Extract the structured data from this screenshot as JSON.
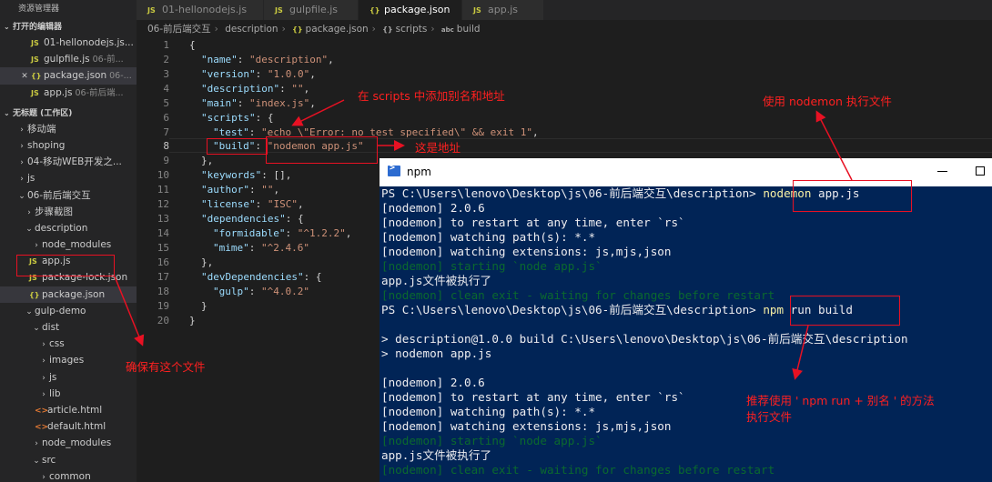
{
  "sidebar": {
    "title": "资源管理器",
    "open_editors_header": "打开的编辑器",
    "open_editors": [
      {
        "icon": "JS",
        "name": "01-hellonodejs.js...",
        "desc": ""
      },
      {
        "icon": "JS",
        "name": "gulpfile.js",
        "desc": "06-前..."
      },
      {
        "icon": "{}",
        "name": "package.json",
        "desc": "06-..."
      },
      {
        "icon": "JS",
        "name": "app.js",
        "desc": "06-前后端..."
      }
    ],
    "workspace_header": "无标题 (工作区)",
    "tree": [
      {
        "name": "移动端"
      },
      {
        "name": "shoping"
      },
      {
        "name": "04-移动WEB开发之..."
      },
      {
        "name": "js"
      },
      {
        "name": "06-前后端交互"
      },
      {
        "name": "步骤截图"
      },
      {
        "name": "description"
      },
      {
        "name": "node_modules"
      },
      {
        "icon": "JS",
        "name": "app.js"
      },
      {
        "icon": "JS",
        "name": "package-lock.json"
      },
      {
        "icon": "{}",
        "name": "package.json"
      },
      {
        "name": "gulp-demo"
      },
      {
        "name": "dist"
      },
      {
        "name": "css"
      },
      {
        "name": "images"
      },
      {
        "name": "js"
      },
      {
        "name": "lib"
      },
      {
        "icon": "<>",
        "name": "article.html"
      },
      {
        "icon": "<>",
        "name": "default.html"
      },
      {
        "name": "node_modules"
      },
      {
        "name": "src"
      },
      {
        "name": "common"
      }
    ]
  },
  "tabs": [
    {
      "icon": "JS",
      "label": "01-hellonodejs.js"
    },
    {
      "icon": "JS",
      "label": "gulpfile.js"
    },
    {
      "icon": "{}",
      "label": "package.json"
    },
    {
      "icon": "JS",
      "label": "app.js"
    }
  ],
  "breadcrumb": {
    "parts": [
      "06-前后端交互",
      "description",
      "package.json",
      "scripts",
      "build"
    ],
    "icons": [
      "{}",
      "{}",
      "abc"
    ]
  },
  "editor": {
    "lines": [
      {
        "n": "1",
        "t": "{"
      },
      {
        "n": "2",
        "k": "\"name\"",
        "v": "\"description\"",
        "e": ","
      },
      {
        "n": "3",
        "k": "\"version\"",
        "v": "\"1.0.0\"",
        "e": ","
      },
      {
        "n": "4",
        "k": "\"description\"",
        "v": "\"\"",
        "e": ","
      },
      {
        "n": "5",
        "k": "\"main\"",
        "v": "\"index.js\"",
        "e": ","
      },
      {
        "n": "6",
        "k": "\"scripts\"",
        "t": "{"
      },
      {
        "n": "7",
        "k": "\"test\"",
        "v": "\"echo \\\"Error: no test specified\\\" && exit 1\"",
        "e": ","
      },
      {
        "n": "8",
        "k": "\"build\"",
        "v": "\"nodemon app.js\""
      },
      {
        "n": "9",
        "t": "},"
      },
      {
        "n": "10",
        "k": "\"keywords\"",
        "t": "[],"
      },
      {
        "n": "11",
        "k": "\"author\"",
        "v": "\"\"",
        "e": ","
      },
      {
        "n": "12",
        "k": "\"license\"",
        "v": "\"ISC\"",
        "e": ","
      },
      {
        "n": "13",
        "k": "\"dependencies\"",
        "t": "{"
      },
      {
        "n": "14",
        "k": "\"formidable\"",
        "v": "\"^1.2.2\"",
        "e": ","
      },
      {
        "n": "15",
        "k": "\"mime\"",
        "v": "\"^2.4.6\""
      },
      {
        "n": "16",
        "t": "},"
      },
      {
        "n": "17",
        "k": "\"devDependencies\"",
        "t": "{"
      },
      {
        "n": "18",
        "k": "\"gulp\"",
        "v": "\"^4.0.2\""
      },
      {
        "n": "19",
        "t": "}"
      },
      {
        "n": "20",
        "t": "}"
      }
    ]
  },
  "terminal": {
    "title": "npm",
    "lines": [
      "PS C:\\Users\\lenovo\\Desktop\\js\\06-前后端交互\\description> ",
      "[nodemon] 2.0.6",
      "[nodemon] to restart at any time, enter `rs`",
      "[nodemon] watching path(s): *.*",
      "[nodemon] watching extensions: js,mjs,json",
      "[nodemon] starting `node app.js`",
      "app.js文件被执行了",
      "[nodemon] clean exit - waiting for changes before restart",
      "PS C:\\Users\\lenovo\\Desktop\\js\\06-前后端交互\\description> ",
      "",
      "> description@1.0.0 build C:\\Users\\lenovo\\Desktop\\js\\06-前后端交互\\description",
      "> nodemon app.js",
      "",
      "[nodemon] 2.0.6",
      "[nodemon] to restart at any time, enter `rs`",
      "[nodemon] watching path(s): *.*",
      "[nodemon] watching extensions: js,mjs,json",
      "[nodemon] starting `node app.js`",
      "app.js文件被执行了",
      "[nodemon] clean exit - waiting for changes before restart"
    ],
    "cmd1_word": "nodemon",
    "cmd1_rest": " app.js",
    "cmd2_word": "npm",
    "cmd2_rest": " run build"
  },
  "annotations": {
    "scripts_note": "在 scripts 中添加别名和地址",
    "address_note": "这是地址",
    "nodemon_note": "使用 nodemon 执行文件",
    "ensure_note": "确保有这个文件",
    "recommend_note_1": "推荐使用 ' npm run + 别名 ' 的方法",
    "recommend_note_2": "执行文件"
  },
  "colors": {
    "annotation": "#e81123",
    "terminal_bg": "#012456",
    "editor_bg": "#1e1e1e"
  }
}
